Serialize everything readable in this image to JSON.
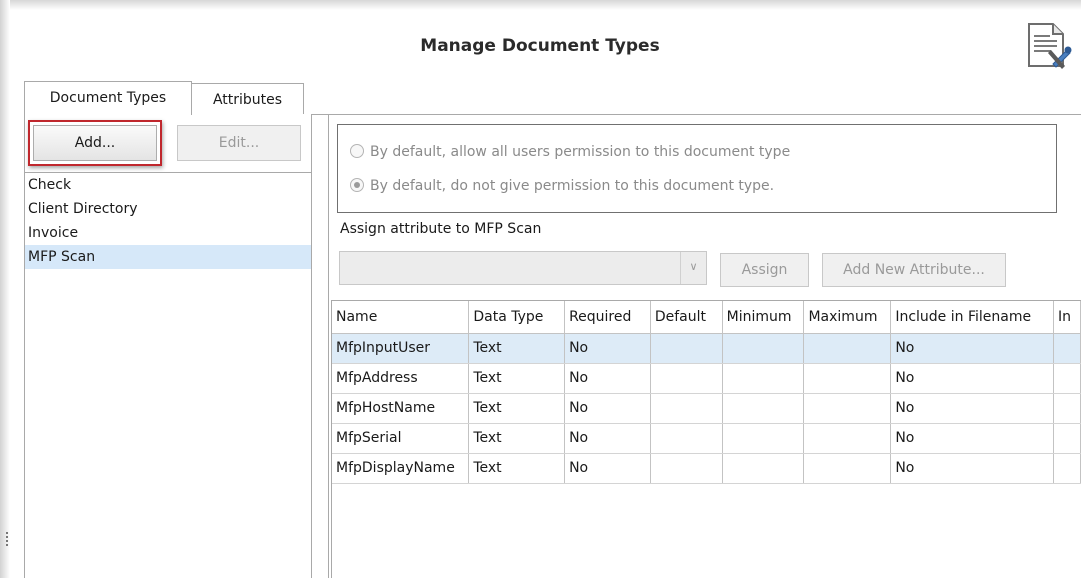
{
  "dialog": {
    "title": "Manage Document Types"
  },
  "tabs": [
    {
      "label": "Document Types",
      "active": true
    },
    {
      "label": "Attributes",
      "active": false
    }
  ],
  "left_panel": {
    "add_label": "Add...",
    "edit_label": "Edit...",
    "items": [
      {
        "label": "Check"
      },
      {
        "label": "Client Directory"
      },
      {
        "label": "Invoice"
      },
      {
        "label": "MFP Scan",
        "selected": true
      }
    ]
  },
  "permissions": {
    "allow_label": "By default, allow all users permission to this document type",
    "deny_label": "By default, do not give permission to this document type.",
    "selected": "deny"
  },
  "assign": {
    "label": "Assign attribute to MFP Scan",
    "combo_value": "",
    "assign_label": "Assign",
    "add_new_label": "Add New Attribute..."
  },
  "grid": {
    "columns": [
      "Name",
      "Data Type",
      "Required",
      "Default",
      "Minimum",
      "Maximum",
      "Include in Filename",
      "In"
    ],
    "rows": [
      {
        "name": "MfpInputUser",
        "data_type": "Text",
        "required": "No",
        "default": "",
        "minimum": "",
        "maximum": "",
        "include": "No",
        "in": "",
        "selected": true
      },
      {
        "name": "MfpAddress",
        "data_type": "Text",
        "required": "No",
        "default": "",
        "minimum": "",
        "maximum": "",
        "include": "No",
        "in": ""
      },
      {
        "name": "MfpHostName",
        "data_type": "Text",
        "required": "No",
        "default": "",
        "minimum": "",
        "maximum": "",
        "include": "No",
        "in": ""
      },
      {
        "name": "MfpSerial",
        "data_type": "Text",
        "required": "No",
        "default": "",
        "minimum": "",
        "maximum": "",
        "include": "No",
        "in": ""
      },
      {
        "name": "MfpDisplayName",
        "data_type": "Text",
        "required": "No",
        "default": "",
        "minimum": "",
        "maximum": "",
        "include": "No",
        "in": ""
      }
    ]
  },
  "colors": {
    "highlight": "#c0272d",
    "selection": "#d6e8f9",
    "border": "#a9a9a9"
  },
  "icons": {
    "corner": "document-settings-icon",
    "combo_arrow": "chevron-down-icon"
  }
}
